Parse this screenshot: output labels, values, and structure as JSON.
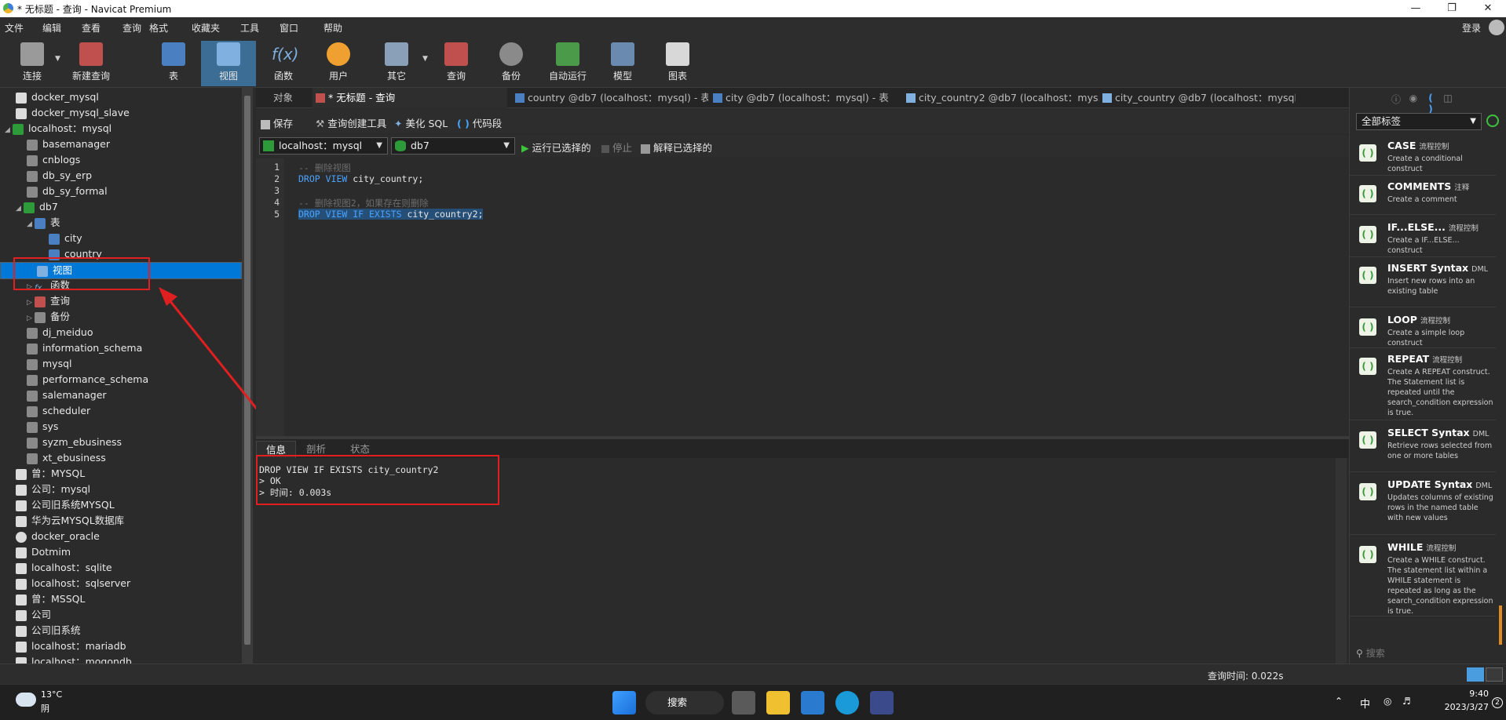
{
  "window": {
    "title": "* 无标题 - 查询 - Navicat Premium",
    "login": "登录"
  },
  "menu": [
    "文件",
    "编辑",
    "查看",
    "查询",
    "格式",
    "收藏夹",
    "工具",
    "窗口",
    "帮助"
  ],
  "toolbar": [
    "连接",
    "新建查询",
    "表",
    "视图",
    "函数",
    "用户",
    "其它",
    "查询",
    "备份",
    "自动运行",
    "模型",
    "图表"
  ],
  "tree": [
    "docker_mysql",
    "docker_mysql_slave",
    "localhost：mysql",
    "basemanager",
    "cnblogs",
    "db_sy_erp",
    "db_sy_formal",
    "db7",
    "表",
    "city",
    "country",
    "视图",
    "函数",
    "查询",
    "备份",
    "dj_meiduo",
    "information_schema",
    "mysql",
    "performance_schema",
    "salemanager",
    "scheduler",
    "sys",
    "syzm_ebusiness",
    "xt_ebusiness",
    "曾：MYSQL",
    "公司：mysql",
    "公司旧系统MYSQL",
    "华为云MYSQL数据库",
    "docker_oracle",
    "Dotmim",
    "localhost：sqlite",
    "localhost：sqlserver",
    "曾：MSSQL",
    "公司",
    "公司旧系统",
    "localhost：mariadb",
    "localhost：mogondb"
  ],
  "tabs": [
    "对象",
    "* 无标题 - 查询",
    "country @db7 (localhost：mysql) - 表",
    "city @db7 (localhost：mysql) - 表",
    "city_country2 @db7 (localhost：mys...",
    "city_country @db7 (localhost：mysql..."
  ],
  "query_toolbar": {
    "save": "保存",
    "builder": "查询创建工具",
    "beautify": "美化 SQL",
    "snippet": "代码段"
  },
  "selectors": {
    "connection": "localhost：mysql",
    "database": "db7",
    "run_selected": "运行已选择的",
    "stop": "停止",
    "explain": "解释已选择的"
  },
  "editor": {
    "line_numbers": [
      "1",
      "2",
      "3",
      "4",
      "5"
    ],
    "line1": "-- 删除视图",
    "line2_kw": "DROP VIEW",
    "line2_tx": " city_country;",
    "line4": "-- 删除视图2，如果存在则删除",
    "line5_kw": "DROP VIEW IF EXISTS",
    "line5_tx": " city_country2;"
  },
  "bottom_tabs": [
    "信息",
    "剖析",
    "状态"
  ],
  "output": [
    "DROP VIEW IF EXISTS city_country2",
    "> OK",
    "> 时间: 0.003s"
  ],
  "right_panel": {
    "filter": "全部标签",
    "snippets": [
      {
        "name": "CASE",
        "cat": "流程控制",
        "desc": "Create a conditional construct"
      },
      {
        "name": "COMMENTS",
        "cat": "注释",
        "desc": "Create a comment"
      },
      {
        "name": "IF...ELSE...",
        "cat": "流程控制",
        "desc": "Create a IF...ELSE... construct"
      },
      {
        "name": "INSERT Syntax",
        "cat": "DML",
        "desc": "Insert new rows into an existing table"
      },
      {
        "name": "LOOP",
        "cat": "流程控制",
        "desc": "Create a simple loop construct"
      },
      {
        "name": "REPEAT",
        "cat": "流程控制",
        "desc": "Create A REPEAT construct. The Statement list is repeated until the search_condition expression is true."
      },
      {
        "name": "SELECT Syntax",
        "cat": "DML",
        "desc": "Retrieve rows selected from one or more tables"
      },
      {
        "name": "UPDATE Syntax",
        "cat": "DML",
        "desc": "Updates columns of existing rows in the named table with new values"
      },
      {
        "name": "WHILE",
        "cat": "流程控制",
        "desc": "Create a WHILE construct. The statement list within a WHILE statement is repeated as long as the search_condition expression is true."
      }
    ],
    "search": "搜索"
  },
  "status": {
    "query_time": "查询时间: 0.022s"
  },
  "taskbar": {
    "temp": "13°C",
    "weather": "阴",
    "search": "搜索",
    "ime": "中",
    "time": "9:40",
    "date": "2023/3/27",
    "badge": "2"
  }
}
